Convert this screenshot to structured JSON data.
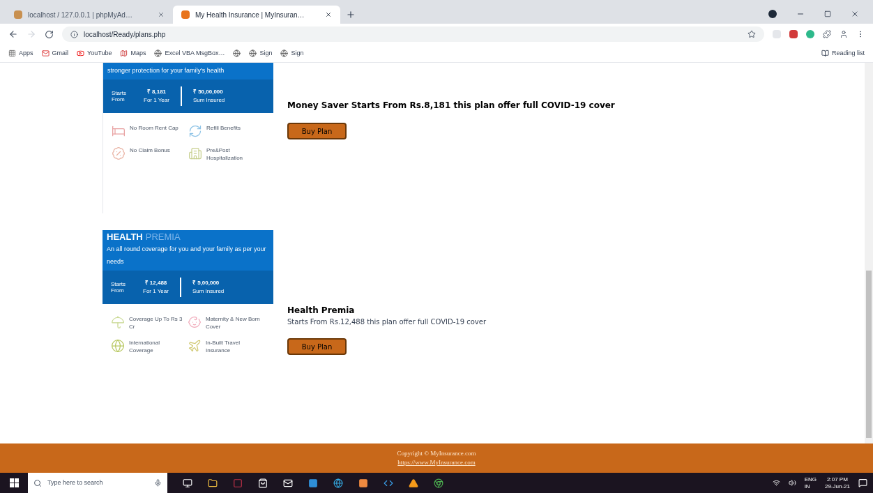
{
  "browser": {
    "tabs": [
      {
        "title": "localhost / 127.0.0.1 | phpMyAd…",
        "selected": false
      },
      {
        "title": "My Health Insurance | MyInsuran…",
        "selected": true
      }
    ],
    "address": "localhost/Ready/plans.php",
    "bookmarks": [
      "Apps",
      "Gmail",
      "YouTube",
      "Maps",
      "Excel VBA MsgBox…",
      "Sign",
      "Sign"
    ],
    "reading_list": "Reading list"
  },
  "plans": [
    {
      "tagline": "stronger protection for your family's health",
      "starts_label": "Starts From",
      "price": "₹ 8,181",
      "price_note": "For 1 Year",
      "sum": "₹ 50,00,000",
      "sum_note": "Sum Insured",
      "features": [
        "No Room Rent Cap",
        "Refill Benefits",
        "No Claim Bonus",
        "Pre&Post Hospitalization"
      ],
      "description": "Money Saver Starts From Rs.8,181 this plan offer full COVID-19 cover",
      "button": "Buy Plan"
    },
    {
      "name_bold": "HEALTH",
      "name_light": "PREMIA",
      "tagline": "An all round coverage for you and your family as per your needs",
      "starts_label": "Starts From",
      "price": "₹ 12,488",
      "price_note": "For 1 Year",
      "sum": "₹ 5,00,000",
      "sum_note": "Sum Insured",
      "features": [
        "Coverage Up To Rs 3 Cr",
        "Maternity & New Born Cover",
        "International Coverage",
        "In-Built Travel Insurance"
      ],
      "title": "Health Premia",
      "description": "Starts From Rs.12,488 this plan offer full COVID-19 cover",
      "button": "Buy Plan"
    }
  ],
  "footer": {
    "copyright": "Copyright © MyInsurance.com",
    "link": "https://www.MyInsurance.com"
  },
  "taskbar": {
    "search_placeholder": "Type here to search",
    "language": "ENG",
    "region": "IN",
    "time": "2:07 PM",
    "date": "29-Jun-21"
  }
}
